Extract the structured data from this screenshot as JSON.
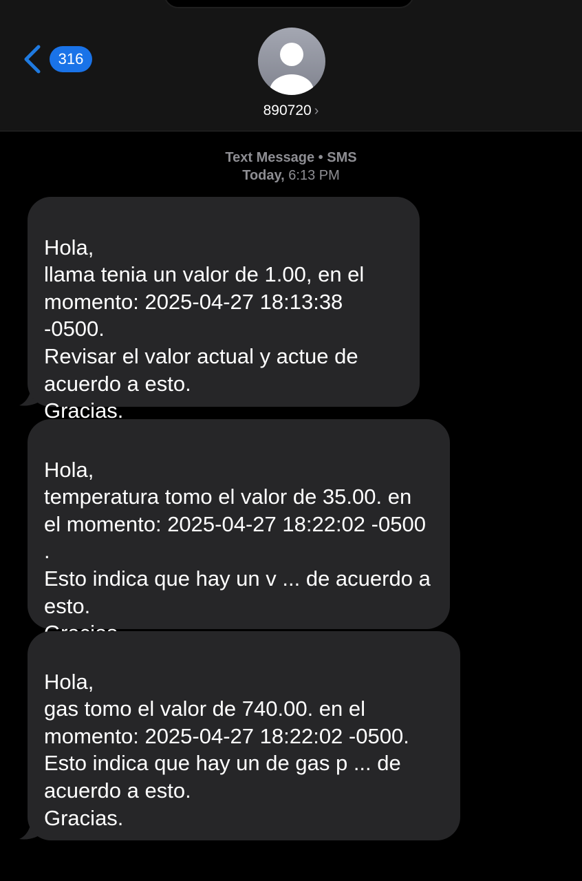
{
  "header": {
    "unread_count": "316",
    "contact_name": "890720",
    "back_icon": "chevron-left-icon",
    "avatar_icon": "person-silhouette-icon",
    "badge_color": "#1a73e8"
  },
  "conversation": {
    "service_label": "Text Message • SMS",
    "day_label": "Today,",
    "time_label": "6:13 PM"
  },
  "messages": [
    {
      "text": "Hola,\nllama tenia un valor de 1.00, en el momento:  2025-04-27 18:13:38 -0500.\nRevisar el valor actual y actue de acuerdo a esto.\nGracias."
    },
    {
      "text": "Hola,\ntemperatura tomo el valor de 35.00. en el momento: 2025-04-27 18:22:02 -0500  .\nEsto indica que hay un v ... de acuerdo a esto.\nGracias."
    },
    {
      "text": "Hola,\ngas  tomo el valor de 740.00. en el momento:  2025-04-27 18:22:02 -0500.\nEsto indica que hay un de gas p ... de acuerdo a esto.\nGracias."
    }
  ],
  "colors": {
    "background": "#000000",
    "header_background": "#151515",
    "bubble_incoming": "#262628",
    "meta_text": "#8e8e93"
  }
}
